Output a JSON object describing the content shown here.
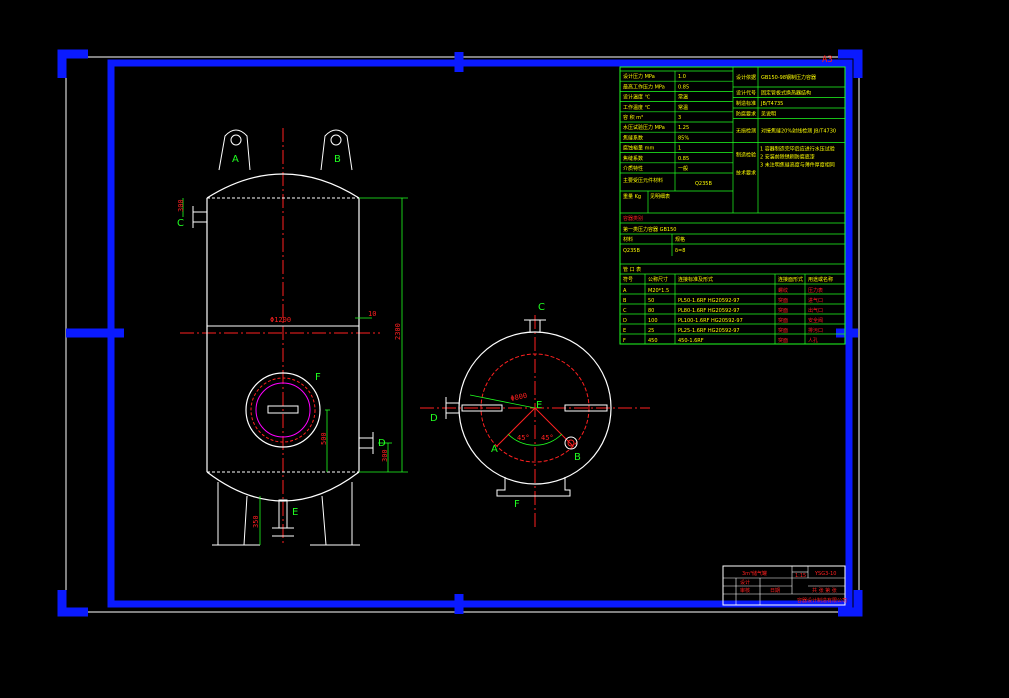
{
  "sheet": {
    "size_code": "A3"
  },
  "vessel_labels": {
    "a": "A",
    "b": "B",
    "c": "C",
    "d": "D",
    "e": "E",
    "f": "F"
  },
  "dimensions": {
    "diameter": "Φ1200",
    "height": "2300",
    "top_offset": "300",
    "nozzle_d_height": "500",
    "nozzle_d_low": "300",
    "leg_height": "350",
    "shell_thickness": "10",
    "plan_diameter": "Φ800",
    "angle_a": "45°",
    "angle_b": "45°"
  },
  "spec_table": {
    "rows": [
      {
        "name": "设计压力  MPa",
        "value": "1.0"
      },
      {
        "name": "最高工作压力  MPa",
        "value": "0.85"
      },
      {
        "name": "设计温度  ℃",
        "value": "常温"
      },
      {
        "name": "工作温度  ℃",
        "value": "常温"
      },
      {
        "name": "容  积  m³",
        "value": "3"
      },
      {
        "name": "水压试验压力  MPa",
        "value": "1.25"
      },
      {
        "name": "焦缝系数",
        "value": "85%"
      },
      {
        "name": "腐蚀裕量  mm",
        "value": "1"
      },
      {
        "name": "焦缝系数",
        "value": "0.85"
      },
      {
        "name": "介质特性",
        "value": "一般"
      }
    ],
    "extra_row": {
      "name": "主要受压元件材料",
      "value": "Q235B"
    },
    "weight_row": {
      "name": "重量 Kg",
      "value": "见明细表"
    },
    "right_rows": [
      {
        "name": "设计依据",
        "value": "GB150-98钢制压力容器"
      },
      {
        "name": "设计代号",
        "value": "固定管板式换热器结构"
      },
      {
        "name": "制造标准",
        "value": "JB/T4735"
      },
      {
        "name": "防腐要求",
        "value": "见说明"
      },
      {
        "name": "无损检测",
        "value": "对接焦缝20%射线检测  JB/T4730"
      }
    ],
    "notes_title": "技术要求",
    "notes": [
      "1 容器制造完毕后应进行水压试验",
      "2 安装前除锈刷防腐底漆",
      "3 未注明焦缝高度与薄件厚度相同"
    ],
    "section_label": "制造检验",
    "code_label": "容器类别",
    "code_value": "第一类压力容器   GB150"
  },
  "material_table": {
    "header": [
      "材料",
      "规格"
    ],
    "row": [
      "Q235B",
      "δ=8"
    ]
  },
  "nozzle_table": {
    "title": "管 口 表",
    "header": [
      "符号",
      "公称尺寸",
      "连接标准及形式",
      "连接面形式",
      "用途或名称"
    ],
    "rows": [
      [
        "A",
        "M20*1.5",
        "",
        "螺纹",
        "压力表"
      ],
      [
        "B",
        "50",
        "PL50-1.6RF    HG20592-97",
        "突面",
        "进气口"
      ],
      [
        "C",
        "80",
        "PL80-1.6RF    HG20592-97",
        "突面",
        "出气口"
      ],
      [
        "D",
        "100",
        "PL100-1.6RF   HG20592-97",
        "突面",
        "安全阀"
      ],
      [
        "E",
        "25",
        "PL25-1.6RF    HG20592-97",
        "突面",
        "排污口"
      ],
      [
        "F",
        "450",
        "450-1.6RF",
        "突面",
        "人孔"
      ]
    ]
  },
  "title_block": {
    "product_name": "3m³储气罐",
    "scale": "1:15",
    "drawing_no": "YSG3-10",
    "sheet": "共 张 第 张",
    "company": "容器设计制造有限公司",
    "row_label_1": "设计",
    "row_label_2": "审核",
    "row_label_3": "日期"
  },
  "colors": {
    "frame": "#0a1aff",
    "outline": "#ffffff",
    "center": "#ff2020",
    "dim": "#20ff20",
    "table": "#20ff20",
    "text": "#ffff00",
    "accent": "#ff00ff"
  }
}
